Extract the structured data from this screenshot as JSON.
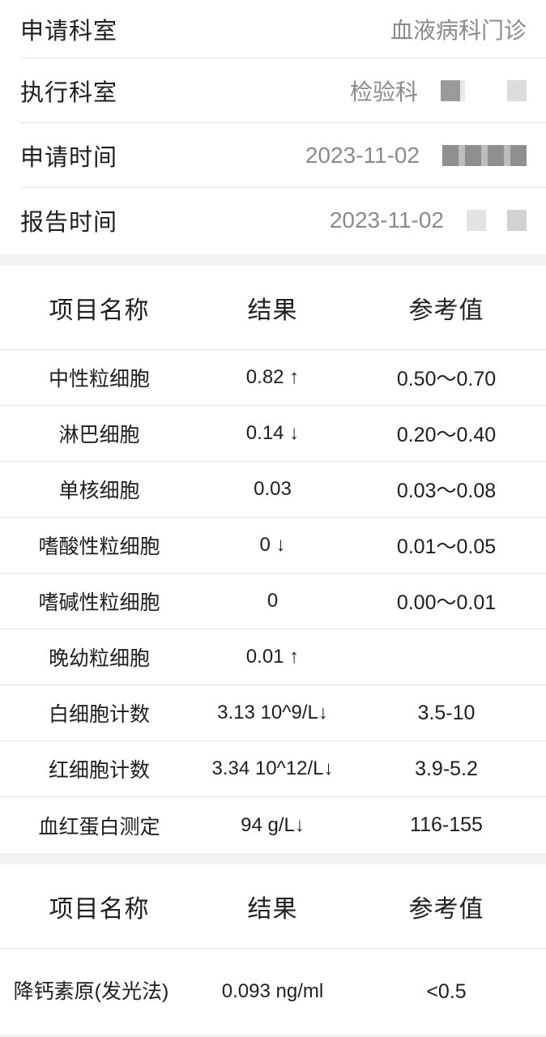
{
  "info": [
    {
      "label": "申请科室",
      "value": "血液病科门诊"
    },
    {
      "label": "执行科室",
      "value": "检验科"
    },
    {
      "label": "申请时间",
      "value": "2023-11-02"
    },
    {
      "label": "报告时间",
      "value": "2023-11-02"
    }
  ],
  "table1": {
    "headers": [
      "项目名称",
      "结果",
      "参考值"
    ],
    "rows": [
      {
        "name": "中性粒细胞",
        "result": "0.82 ↑",
        "status": "up",
        "ref": "0.50～0.70"
      },
      {
        "name": "淋巴细胞",
        "result": "0.14 ↓",
        "status": "down",
        "ref": "0.20～0.40"
      },
      {
        "name": "单核细胞",
        "result": "0.03",
        "status": "normal",
        "ref": "0.03～0.08"
      },
      {
        "name": "嗜酸性粒细胞",
        "result": "0 ↓",
        "status": "down",
        "ref": "0.01～0.05"
      },
      {
        "name": "嗜碱性粒细胞",
        "result": "0",
        "status": "normal",
        "ref": "0.00～0.01"
      },
      {
        "name": "晚幼粒细胞",
        "result": "0.01 ↑",
        "status": "up",
        "ref": ""
      },
      {
        "name": "白细胞计数",
        "result": "3.13 10^9/L↓",
        "status": "down",
        "ref": "3.5-10"
      },
      {
        "name": "红细胞计数",
        "result": "3.34 10^12/L↓",
        "status": "down",
        "ref": "3.9-5.2"
      },
      {
        "name": "血红蛋白测定",
        "result": "94 g/L↓",
        "status": "down",
        "ref": "116-155"
      }
    ]
  },
  "table2": {
    "headers": [
      "项目名称",
      "结果",
      "参考值"
    ],
    "rows": [
      {
        "name": "降钙素原(发光法)",
        "result": "0.093 ng/ml",
        "status": "normal",
        "ref": "<0.5"
      }
    ]
  },
  "colors": {
    "up": "#e05a55",
    "down": "#3dbd63",
    "normal": "#1e1e1e"
  }
}
